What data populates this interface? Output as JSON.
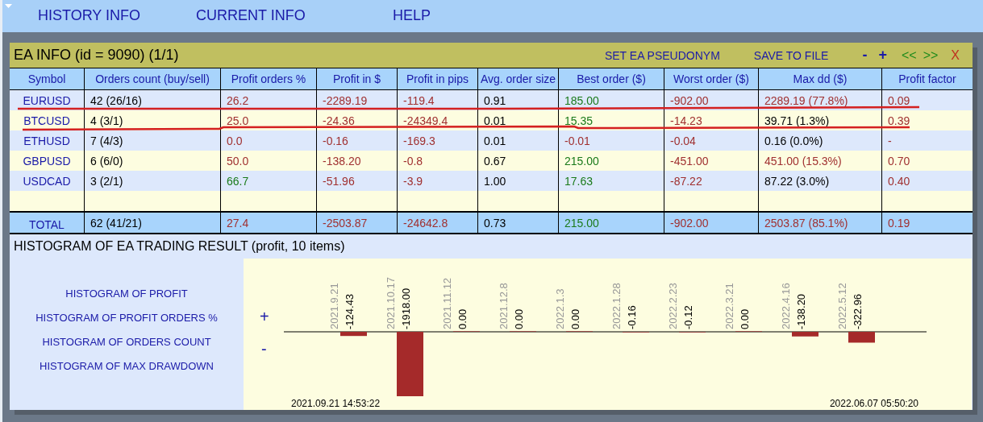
{
  "menu": [
    {
      "label": "HISTORY INFO"
    },
    {
      "label": "CURRENT INFO"
    },
    {
      "label": "HELP"
    }
  ],
  "panel": {
    "title": "EA INFO (id = 9090) (1/1)",
    "actions": [
      {
        "label": "SET EA PSEUDONYM",
        "kind": "text"
      },
      {
        "label": "SAVE TO FILE",
        "kind": "text"
      },
      {
        "label": "-",
        "kind": "zoom"
      },
      {
        "label": "+",
        "kind": "zoom"
      },
      {
        "label": "<<",
        "kind": "nav"
      },
      {
        "label": ">>",
        "kind": "nav"
      },
      {
        "label": "X",
        "kind": "close"
      }
    ]
  },
  "table": {
    "columns": [
      "Symbol",
      "Orders count (buy/sell)",
      "Profit orders %",
      "Profit in $",
      "Profit in pips",
      "Avg. order size",
      "Best order ($)",
      "Worst order ($)",
      "Max dd ($)",
      "Profit factor"
    ],
    "rows": [
      {
        "cells": [
          {
            "text": "EURUSD",
            "color": "#1a1aa8"
          },
          {
            "text": "42 (26/16)",
            "color": "#000000"
          },
          {
            "text": "26.2",
            "color": "#a03030"
          },
          {
            "text": "-2289.19",
            "color": "#a03030"
          },
          {
            "text": "-119.4",
            "color": "#a03030"
          },
          {
            "text": "0.91",
            "color": "#000000"
          },
          {
            "text": "185.00",
            "color": "#1a7a1a"
          },
          {
            "text": "-902.00",
            "color": "#a03030"
          },
          {
            "text": "2289.19 (77.8%)",
            "color": "#a03030"
          },
          {
            "text": "0.09",
            "color": "#a03030"
          }
        ]
      },
      {
        "cells": [
          {
            "text": "BTCUSD",
            "color": "#1a1aa8"
          },
          {
            "text": "4 (3/1)",
            "color": "#000000"
          },
          {
            "text": "25.0",
            "color": "#a03030"
          },
          {
            "text": "-24.36",
            "color": "#a03030"
          },
          {
            "text": "-24349.4",
            "color": "#a03030"
          },
          {
            "text": "0.01",
            "color": "#000000"
          },
          {
            "text": "15.35",
            "color": "#1a7a1a"
          },
          {
            "text": "-14.23",
            "color": "#a03030"
          },
          {
            "text": "39.71 (1.3%)",
            "color": "#000000"
          },
          {
            "text": "0.39",
            "color": "#a03030"
          }
        ]
      },
      {
        "cells": [
          {
            "text": "ETHUSD",
            "color": "#1a1aa8"
          },
          {
            "text": "7 (4/3)",
            "color": "#000000"
          },
          {
            "text": "0.0",
            "color": "#a03030"
          },
          {
            "text": "-0.16",
            "color": "#a03030"
          },
          {
            "text": "-169.3",
            "color": "#a03030"
          },
          {
            "text": "0.01",
            "color": "#000000"
          },
          {
            "text": "-0.01",
            "color": "#a03030"
          },
          {
            "text": "-0.04",
            "color": "#a03030"
          },
          {
            "text": "0.16 (0.0%)",
            "color": "#000000"
          },
          {
            "text": "-",
            "color": "#a03030"
          }
        ]
      },
      {
        "cells": [
          {
            "text": "GBPUSD",
            "color": "#1a1aa8"
          },
          {
            "text": "6 (6/0)",
            "color": "#000000"
          },
          {
            "text": "50.0",
            "color": "#a03030"
          },
          {
            "text": "-138.20",
            "color": "#a03030"
          },
          {
            "text": "-0.8",
            "color": "#a03030"
          },
          {
            "text": "0.67",
            "color": "#000000"
          },
          {
            "text": "215.00",
            "color": "#1a7a1a"
          },
          {
            "text": "-451.00",
            "color": "#a03030"
          },
          {
            "text": "451.00 (15.3%)",
            "color": "#a03030"
          },
          {
            "text": "0.70",
            "color": "#a03030"
          }
        ]
      },
      {
        "cells": [
          {
            "text": "USDCAD",
            "color": "#1a1aa8"
          },
          {
            "text": "3 (2/1)",
            "color": "#000000"
          },
          {
            "text": "66.7",
            "color": "#1a7a1a"
          },
          {
            "text": "-51.96",
            "color": "#a03030"
          },
          {
            "text": "-3.9",
            "color": "#a03030"
          },
          {
            "text": "1.00",
            "color": "#000000"
          },
          {
            "text": "17.63",
            "color": "#1a7a1a"
          },
          {
            "text": "-87.22",
            "color": "#a03030"
          },
          {
            "text": "87.22 (3.0%)",
            "color": "#000000"
          },
          {
            "text": "0.40",
            "color": "#a03030"
          }
        ]
      }
    ],
    "total": {
      "cells": [
        {
          "text": "TOTAL",
          "color": "#1a1aa8"
        },
        {
          "text": "62 (41/21)",
          "color": "#000000"
        },
        {
          "text": "27.4",
          "color": "#a03030"
        },
        {
          "text": "-2503.87",
          "color": "#a03030"
        },
        {
          "text": "-24642.8",
          "color": "#a03030"
        },
        {
          "text": "0.73",
          "color": "#000000"
        },
        {
          "text": "215.00",
          "color": "#1a7a1a"
        },
        {
          "text": "-902.00",
          "color": "#a03030"
        },
        {
          "text": "2503.87 (85.1%)",
          "color": "#a03030"
        },
        {
          "text": "0.19",
          "color": "#a03030"
        }
      ]
    }
  },
  "histogram": {
    "title": "HISTOGRAM OF EA TRADING RESULT (profit, 10 items)",
    "links": [
      "HISTOGRAM OF PROFIT",
      "HISTOGRAM OF PROFIT ORDERS %",
      "HISTOGRAM OF ORDERS COUNT",
      "HISTOGRAM OF MAX DRAWDOWN"
    ],
    "plus_sign": "+",
    "minus_sign": "-",
    "start_time": "2021.09.21 14:53:22",
    "end_time": "2022.06.07 05:50:20",
    "chart_data": {
      "type": "bar",
      "categories": [
        "2021.9.21",
        "2021.10.17",
        "2021.11.12",
        "2021.12.8",
        "2022.1.3",
        "2022.1.28",
        "2022.2.23",
        "2022.3.21",
        "2022.4.16",
        "2022.5.12"
      ],
      "values": [
        -124.43,
        -1918.0,
        0.0,
        0.0,
        0.0,
        -0.16,
        -0.12,
        0.0,
        -138.2,
        -322.96
      ],
      "data_labels": true,
      "value_labels": [
        "-124.43",
        "-1918.00",
        "0.00",
        "0.00",
        "0.00",
        "-0.16",
        "-0.12",
        "0.00",
        "-138.20",
        "-322.96"
      ]
    }
  }
}
